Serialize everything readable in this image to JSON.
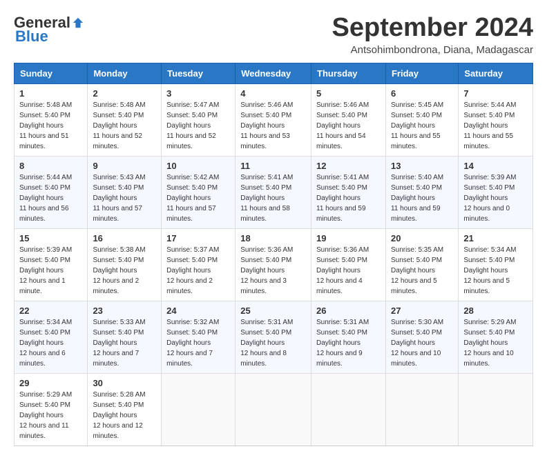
{
  "header": {
    "logo_general": "General",
    "logo_blue": "Blue",
    "month_title": "September 2024",
    "location": "Antsohimbondrona, Diana, Madagascar"
  },
  "days_of_week": [
    "Sunday",
    "Monday",
    "Tuesday",
    "Wednesday",
    "Thursday",
    "Friday",
    "Saturday"
  ],
  "weeks": [
    [
      {
        "day": "1",
        "sunrise": "5:48 AM",
        "sunset": "5:40 PM",
        "daylight": "11 hours and 51 minutes."
      },
      {
        "day": "2",
        "sunrise": "5:48 AM",
        "sunset": "5:40 PM",
        "daylight": "11 hours and 52 minutes."
      },
      {
        "day": "3",
        "sunrise": "5:47 AM",
        "sunset": "5:40 PM",
        "daylight": "11 hours and 52 minutes."
      },
      {
        "day": "4",
        "sunrise": "5:46 AM",
        "sunset": "5:40 PM",
        "daylight": "11 hours and 53 minutes."
      },
      {
        "day": "5",
        "sunrise": "5:46 AM",
        "sunset": "5:40 PM",
        "daylight": "11 hours and 54 minutes."
      },
      {
        "day": "6",
        "sunrise": "5:45 AM",
        "sunset": "5:40 PM",
        "daylight": "11 hours and 55 minutes."
      },
      {
        "day": "7",
        "sunrise": "5:44 AM",
        "sunset": "5:40 PM",
        "daylight": "11 hours and 55 minutes."
      }
    ],
    [
      {
        "day": "8",
        "sunrise": "5:44 AM",
        "sunset": "5:40 PM",
        "daylight": "11 hours and 56 minutes."
      },
      {
        "day": "9",
        "sunrise": "5:43 AM",
        "sunset": "5:40 PM",
        "daylight": "11 hours and 57 minutes."
      },
      {
        "day": "10",
        "sunrise": "5:42 AM",
        "sunset": "5:40 PM",
        "daylight": "11 hours and 57 minutes."
      },
      {
        "day": "11",
        "sunrise": "5:41 AM",
        "sunset": "5:40 PM",
        "daylight": "11 hours and 58 minutes."
      },
      {
        "day": "12",
        "sunrise": "5:41 AM",
        "sunset": "5:40 PM",
        "daylight": "11 hours and 59 minutes."
      },
      {
        "day": "13",
        "sunrise": "5:40 AM",
        "sunset": "5:40 PM",
        "daylight": "11 hours and 59 minutes."
      },
      {
        "day": "14",
        "sunrise": "5:39 AM",
        "sunset": "5:40 PM",
        "daylight": "12 hours and 0 minutes."
      }
    ],
    [
      {
        "day": "15",
        "sunrise": "5:39 AM",
        "sunset": "5:40 PM",
        "daylight": "12 hours and 1 minute."
      },
      {
        "day": "16",
        "sunrise": "5:38 AM",
        "sunset": "5:40 PM",
        "daylight": "12 hours and 2 minutes."
      },
      {
        "day": "17",
        "sunrise": "5:37 AM",
        "sunset": "5:40 PM",
        "daylight": "12 hours and 2 minutes."
      },
      {
        "day": "18",
        "sunrise": "5:36 AM",
        "sunset": "5:40 PM",
        "daylight": "12 hours and 3 minutes."
      },
      {
        "day": "19",
        "sunrise": "5:36 AM",
        "sunset": "5:40 PM",
        "daylight": "12 hours and 4 minutes."
      },
      {
        "day": "20",
        "sunrise": "5:35 AM",
        "sunset": "5:40 PM",
        "daylight": "12 hours and 5 minutes."
      },
      {
        "day": "21",
        "sunrise": "5:34 AM",
        "sunset": "5:40 PM",
        "daylight": "12 hours and 5 minutes."
      }
    ],
    [
      {
        "day": "22",
        "sunrise": "5:34 AM",
        "sunset": "5:40 PM",
        "daylight": "12 hours and 6 minutes."
      },
      {
        "day": "23",
        "sunrise": "5:33 AM",
        "sunset": "5:40 PM",
        "daylight": "12 hours and 7 minutes."
      },
      {
        "day": "24",
        "sunrise": "5:32 AM",
        "sunset": "5:40 PM",
        "daylight": "12 hours and 7 minutes."
      },
      {
        "day": "25",
        "sunrise": "5:31 AM",
        "sunset": "5:40 PM",
        "daylight": "12 hours and 8 minutes."
      },
      {
        "day": "26",
        "sunrise": "5:31 AM",
        "sunset": "5:40 PM",
        "daylight": "12 hours and 9 minutes."
      },
      {
        "day": "27",
        "sunrise": "5:30 AM",
        "sunset": "5:40 PM",
        "daylight": "12 hours and 10 minutes."
      },
      {
        "day": "28",
        "sunrise": "5:29 AM",
        "sunset": "5:40 PM",
        "daylight": "12 hours and 10 minutes."
      }
    ],
    [
      {
        "day": "29",
        "sunrise": "5:29 AM",
        "sunset": "5:40 PM",
        "daylight": "12 hours and 11 minutes."
      },
      {
        "day": "30",
        "sunrise": "5:28 AM",
        "sunset": "5:40 PM",
        "daylight": "12 hours and 12 minutes."
      },
      null,
      null,
      null,
      null,
      null
    ]
  ]
}
